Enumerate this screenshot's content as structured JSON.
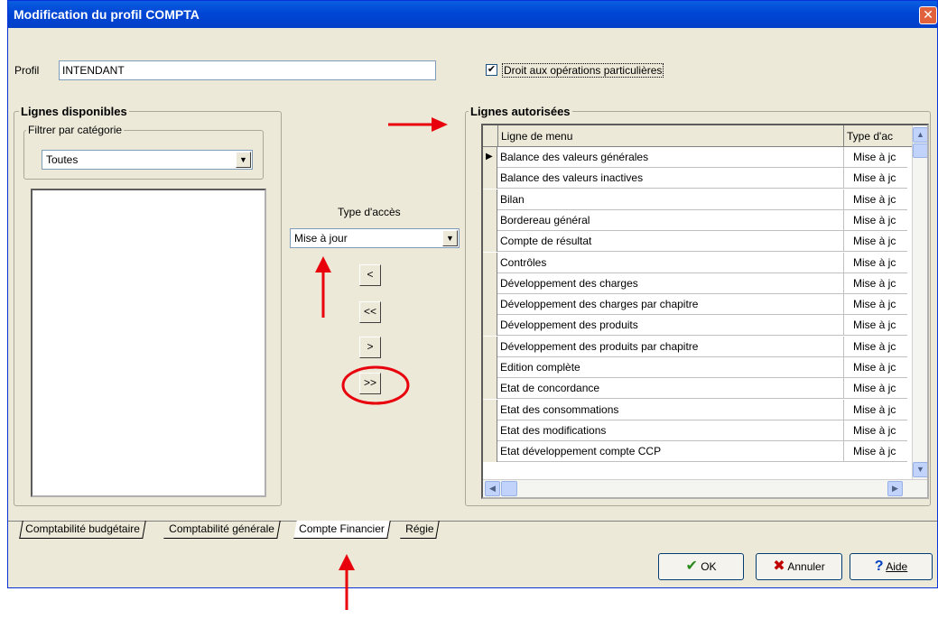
{
  "window": {
    "title": "Modification du profil COMPTA",
    "close_glyph": "✕"
  },
  "profil": {
    "label": "Profil",
    "value": "INTENDANT"
  },
  "droit": {
    "label": "Droit aux opérations particulières",
    "checked_glyph": "✔"
  },
  "dispo": {
    "title": "Lignes disponibles",
    "filter_title": "Filtrer par catégorie",
    "filter_value": "Toutes"
  },
  "acces": {
    "label": "Type d'accès",
    "value": "Mise à jour"
  },
  "transfer": {
    "one_left": "<",
    "all_left": "<<",
    "one_right": ">",
    "all_right": ">>"
  },
  "autorisees": {
    "title": "Lignes autorisées",
    "col_menu": "Ligne de menu",
    "col_type": "Type d'ac",
    "rows": [
      {
        "menu": "Balance des valeurs générales",
        "type": "Mise à jc"
      },
      {
        "menu": "Balance des valeurs inactives",
        "type": "Mise à jc"
      },
      {
        "menu": "Bilan",
        "type": "Mise à jc"
      },
      {
        "menu": "Bordereau général",
        "type": "Mise à jc"
      },
      {
        "menu": "Compte de résultat",
        "type": "Mise à jc"
      },
      {
        "menu": "Contrôles",
        "type": "Mise à jc"
      },
      {
        "menu": "Développement des charges",
        "type": "Mise à jc"
      },
      {
        "menu": "Développement des charges par chapitre",
        "type": "Mise à jc"
      },
      {
        "menu": "Développement des produits",
        "type": "Mise à jc"
      },
      {
        "menu": "Développement des produits par chapitre",
        "type": "Mise à jc"
      },
      {
        "menu": "Edition complète",
        "type": "Mise à jc"
      },
      {
        "menu": "Etat de concordance",
        "type": "Mise à jc"
      },
      {
        "menu": "Etat des consommations",
        "type": "Mise à jc"
      },
      {
        "menu": "Etat des modifications",
        "type": "Mise à jc"
      },
      {
        "menu": "Etat développement compte CCP",
        "type": "Mise à jc"
      }
    ]
  },
  "tabs": [
    {
      "label": "Comptabilité budgétaire"
    },
    {
      "label": "Comptabilité générale"
    },
    {
      "label": "Compte Financier"
    },
    {
      "label": "Régie"
    }
  ],
  "buttons": {
    "ok": "OK",
    "annuler": "Annuler",
    "aide": "Aide"
  },
  "colors": {
    "titlebar": "#0054e3",
    "annotation": "#e8000d",
    "dialog_bg": "#ece9d8"
  }
}
